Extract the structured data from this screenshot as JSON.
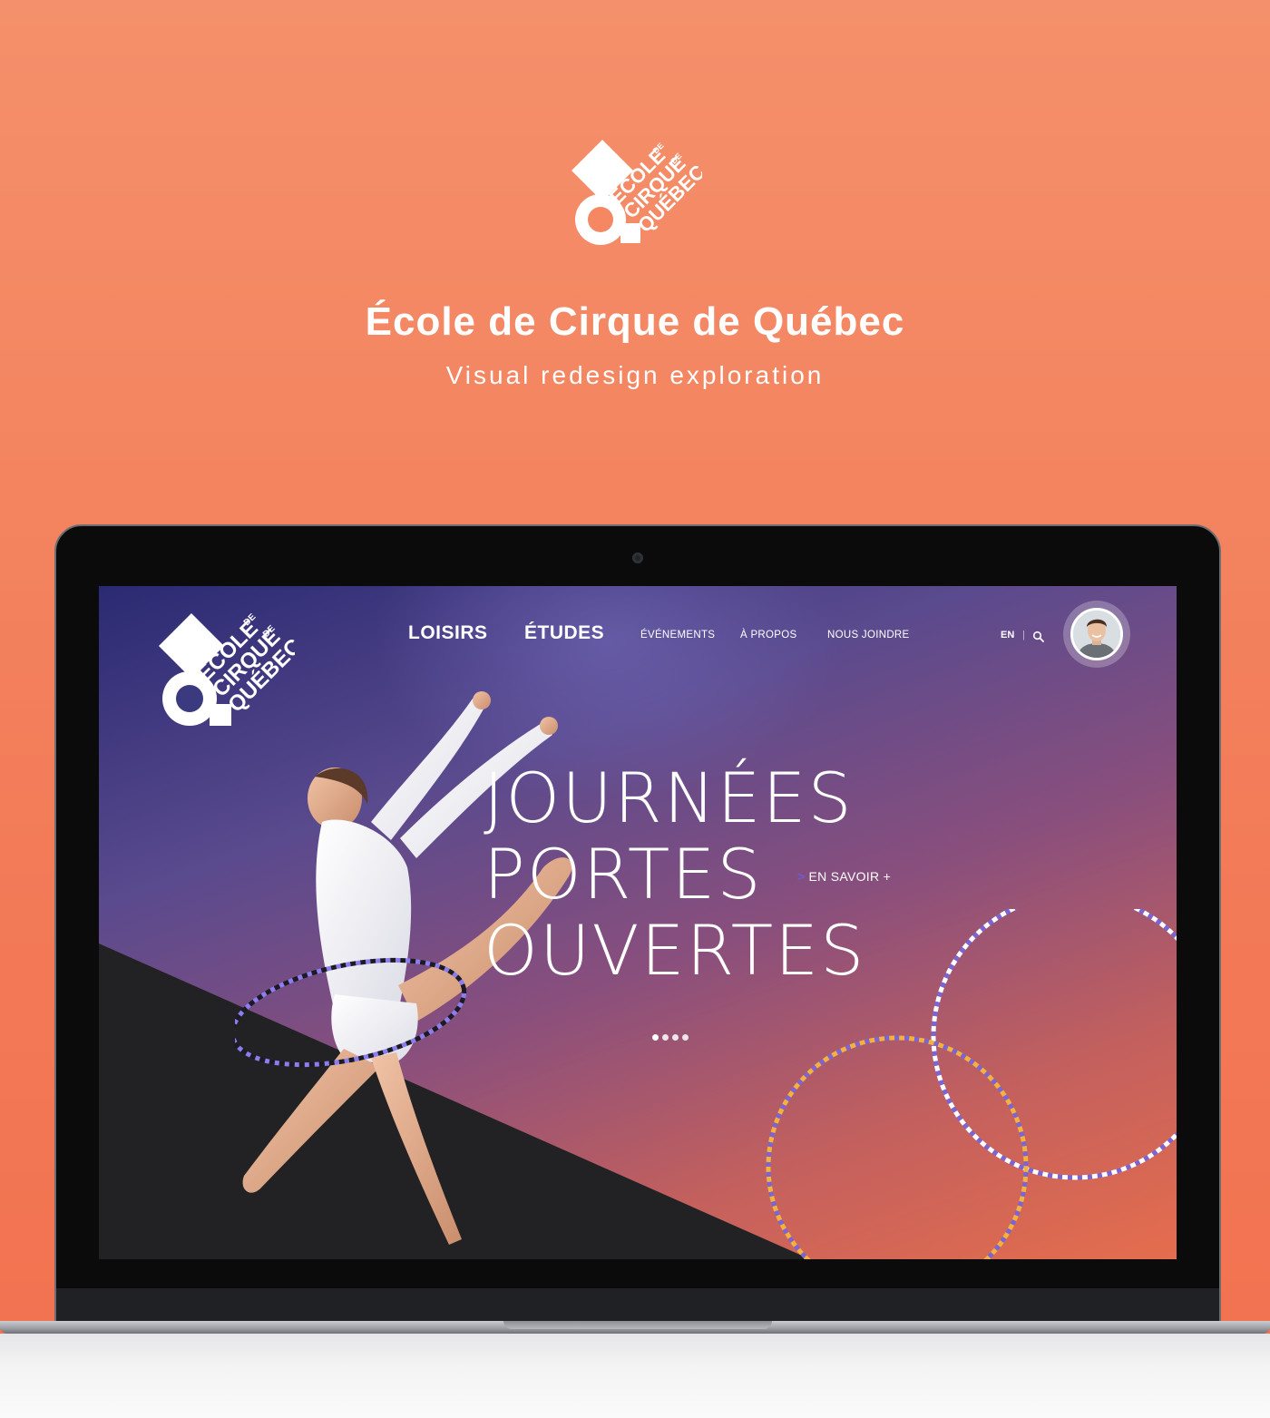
{
  "brand": {
    "title": "École de Cirque de Québec",
    "subtitle": "Visual redesign exploration",
    "logo_text": [
      "ÉCOLE",
      "DE",
      "CIRQUE",
      "DE",
      "QUÉBEC"
    ],
    "colors": {
      "background": "#f37b58",
      "screen_navy": "#2a2a72",
      "screen_coral": "#e56d4d",
      "accent_purple": "#6d5ad6",
      "dark_wedge": "#222224"
    }
  },
  "site": {
    "nav": {
      "main": [
        "LOISIRS",
        "ÉTUDES"
      ],
      "secondary": [
        "ÉVÉNEMENTS",
        "À PROPOS",
        "NOUS JOINDRE"
      ],
      "lang": "EN",
      "separator": "|",
      "search_icon": "search-icon",
      "avatar": "user-avatar"
    },
    "hero": {
      "lines": [
        "JOURNÉES",
        "PORTES",
        "OUVERTES"
      ],
      "cta_arrow": ">",
      "cta_label": "EN SAVOIR +",
      "slides_total": 4,
      "slide_active": 1
    }
  }
}
